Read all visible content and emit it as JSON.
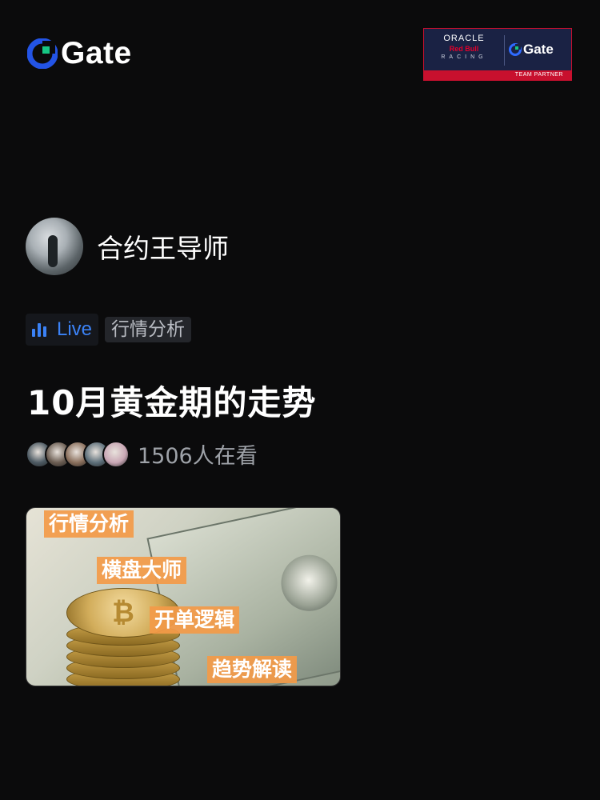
{
  "brand": {
    "logo_text": "Gate",
    "primary_color": "#2354e6",
    "accent_color": "#16c784"
  },
  "partner_badge": {
    "line1": "ORACLE",
    "line2": "Red Bull",
    "line3": "RACING",
    "gate_text": "Gate",
    "strip": "TEAM PARTNER"
  },
  "host": {
    "name": "合约王导师"
  },
  "tags": {
    "live": "Live",
    "category": "行情分析"
  },
  "title": "10月黄金期的走势",
  "viewers": {
    "count_text": "1506人在看",
    "avatar_colors": [
      "#4d5a63",
      "#6b5d52",
      "#8a6f5c",
      "#5d6f7a",
      "#c9a7b5"
    ]
  },
  "thumbnail": {
    "labels": [
      "行情分析",
      "横盘大师",
      "开单逻辑",
      "趋势解读"
    ],
    "coin_symbol": "₿"
  }
}
